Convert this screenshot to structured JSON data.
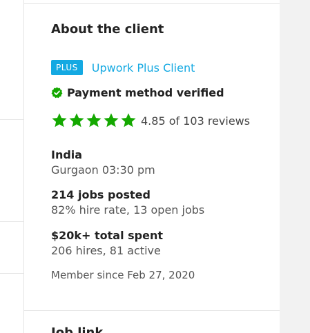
{
  "client_panel": {
    "heading": "About the client",
    "plus_badge": "PLUS",
    "plus_link": "Upwork Plus Client",
    "payment_verified": "Payment method verified",
    "rating": {
      "stars": 5,
      "text": "4.85 of 103 reviews"
    },
    "location": {
      "country": "India",
      "city_time": "Gurgaon 03:30 pm"
    },
    "jobs": {
      "posted": "214 jobs posted",
      "detail": "82% hire rate, 13 open jobs"
    },
    "spend": {
      "total": "$20k+ total spent",
      "detail": "206 hires, 81 active"
    },
    "member_since": "Member since Feb 27, 2020",
    "next_section_heading": "Job link"
  },
  "colors": {
    "accent_blue": "#14a9e2",
    "verified_green": "#14a800",
    "star_green": "#14a800"
  },
  "icons": {
    "verified": "check-circle-icon",
    "rating": "star-icon"
  }
}
